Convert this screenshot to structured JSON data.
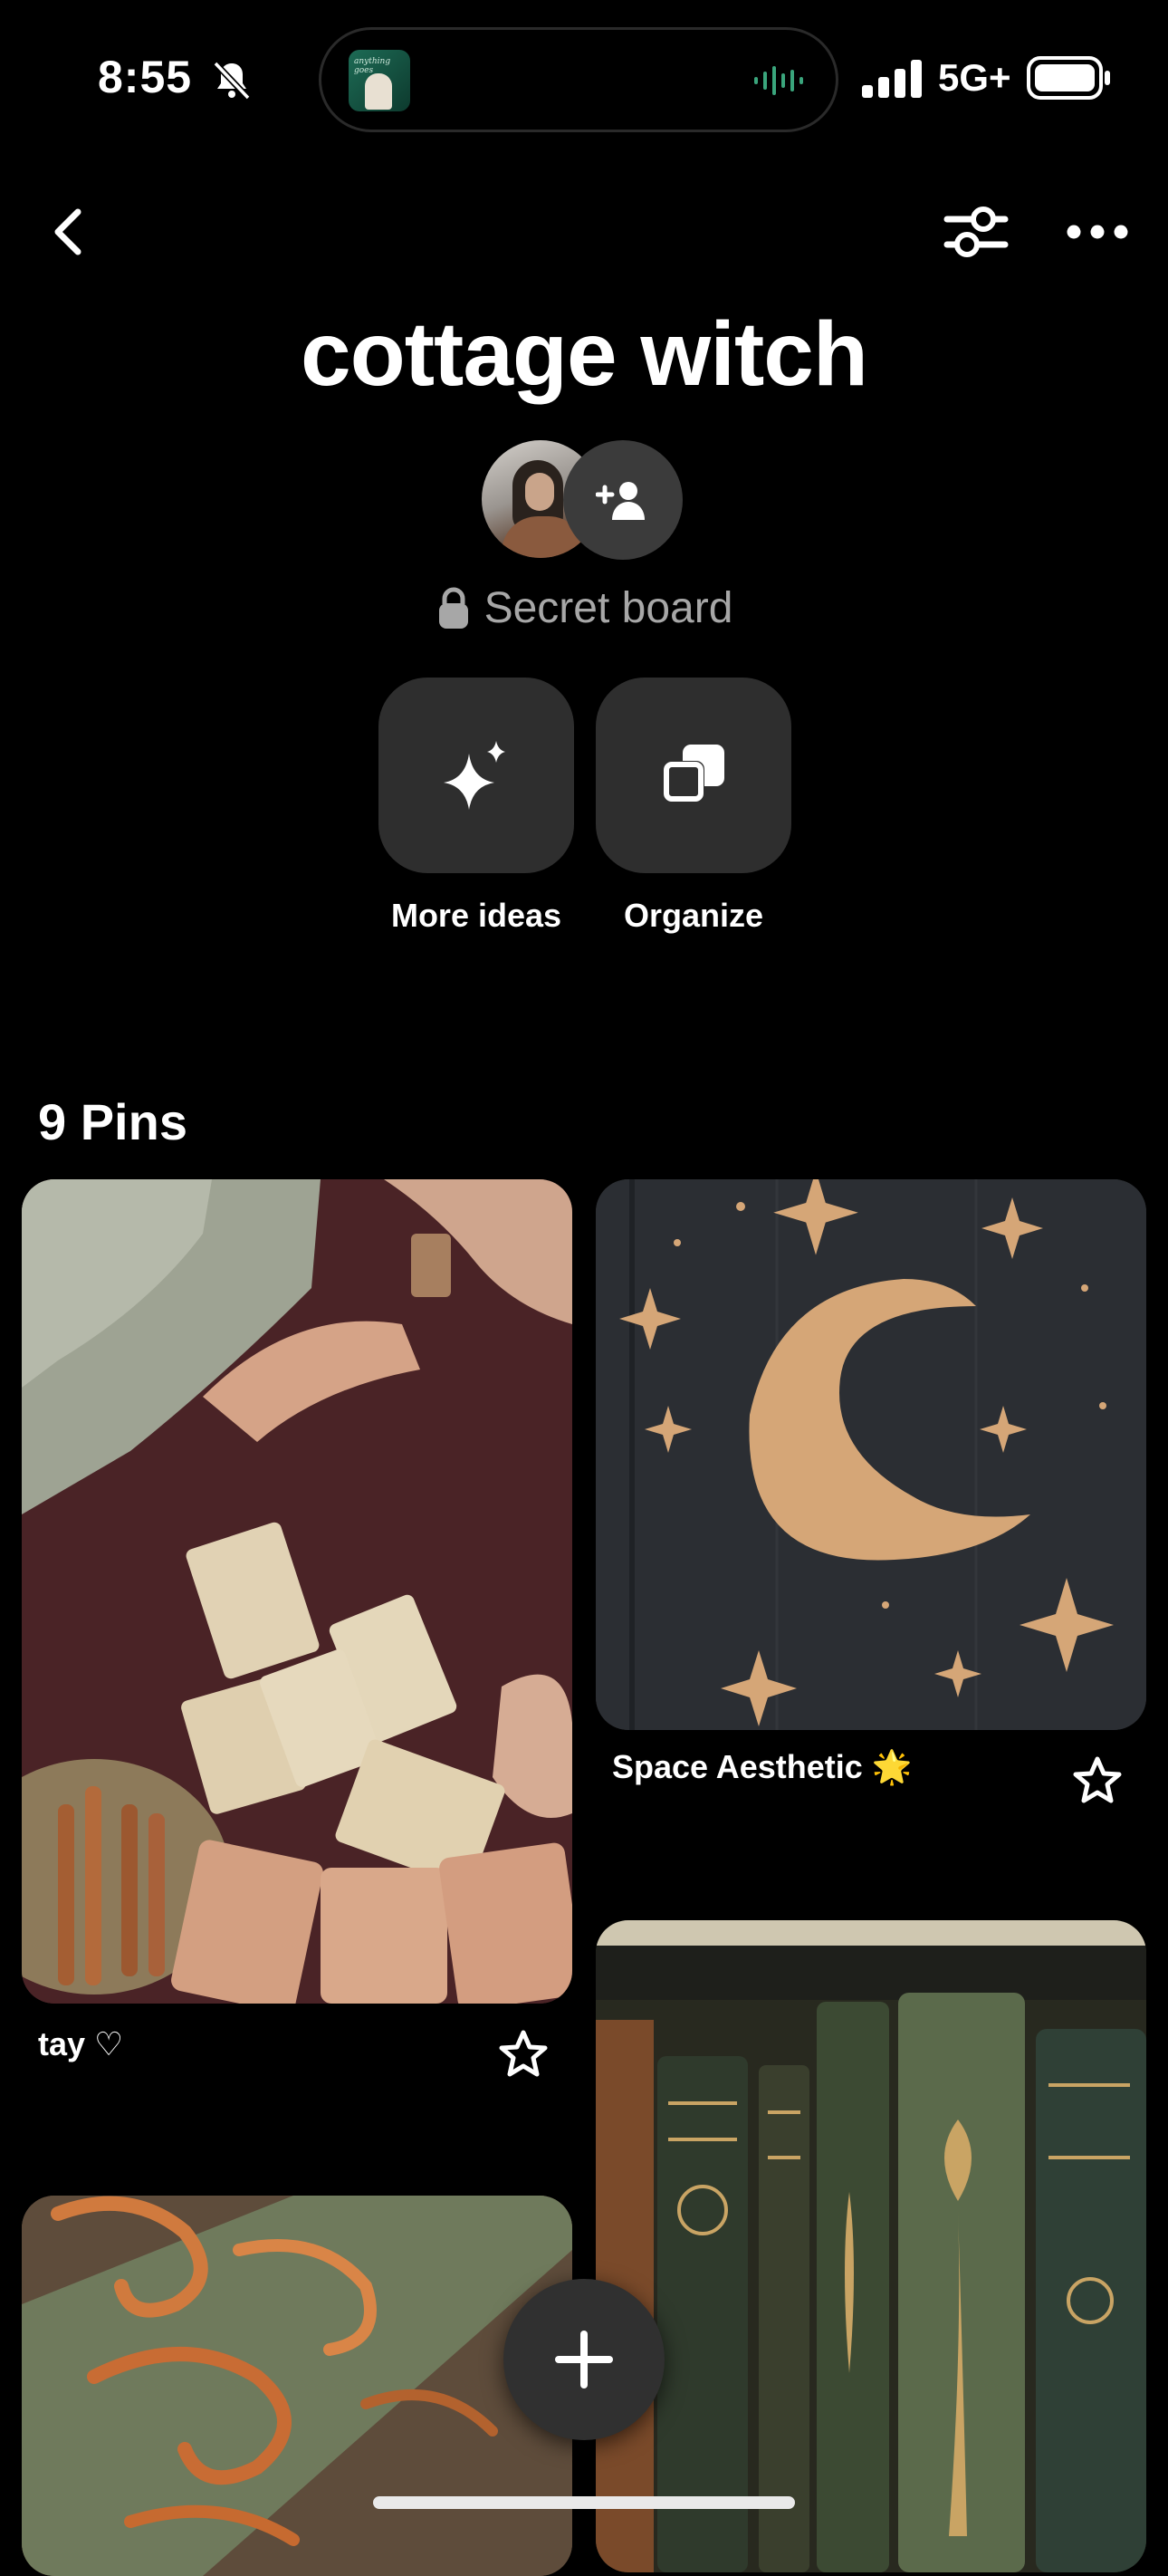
{
  "status_bar": {
    "time": "8:55",
    "network": "5G+",
    "icons": [
      "bell-slash-icon",
      "now-playing-artwork",
      "waveform-icon",
      "signal-icon",
      "battery-icon"
    ]
  },
  "nav": {
    "back_icon": "chevron-left-icon",
    "filter_icon": "sliders-icon",
    "more_icon": "ellipsis-icon"
  },
  "board": {
    "title": "cottage witch",
    "privacy_label": "Secret board",
    "privacy_icon": "lock-icon",
    "invite_icon": "add-person-icon"
  },
  "actions": [
    {
      "label": "More ideas",
      "icon": "sparkle-icon"
    },
    {
      "label": "Organize",
      "icon": "stacked-squares-icon"
    }
  ],
  "pins_header": "9 Pins",
  "pins": [
    {
      "caption": "tay ♡",
      "image": "tarot cards on red cloth",
      "saved_icon": "star-outline-icon"
    },
    {
      "caption": "Space Aesthetic 🌟",
      "image": "golden crescent moon and stars",
      "saved_icon": "star-outline-icon"
    },
    {
      "caption": "",
      "image": "antique book spines"
    },
    {
      "caption": "",
      "image": "autumn leaf spirals"
    }
  ],
  "fab_icon": "plus-icon",
  "colors": {
    "background": "#000000",
    "surface": "#2e2e2e",
    "muted_text": "#a7a7a7"
  }
}
